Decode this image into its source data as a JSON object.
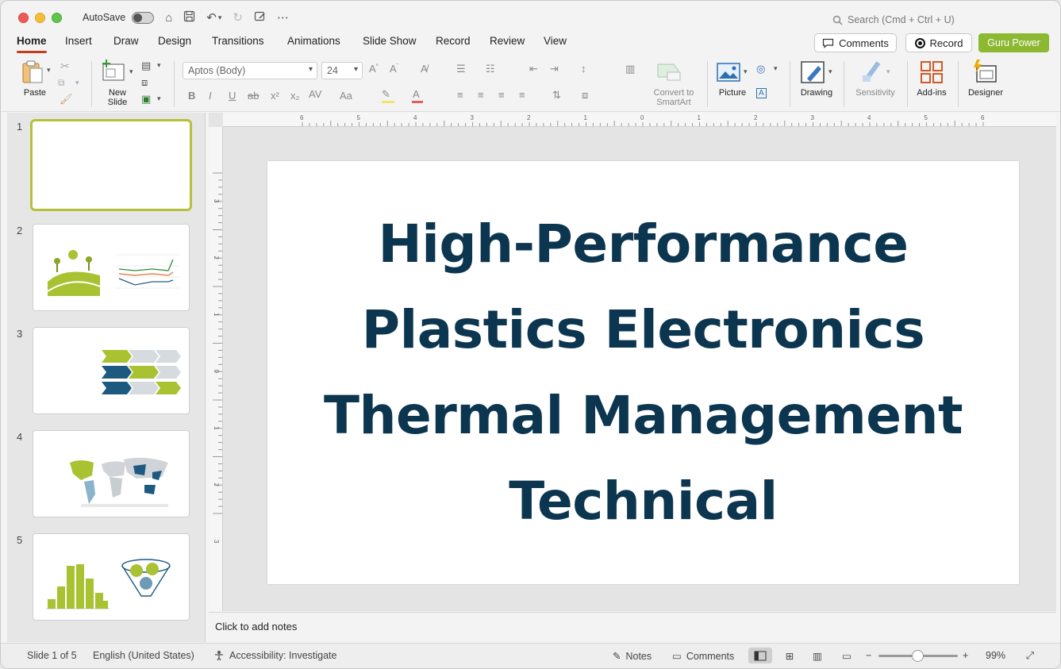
{
  "titlebar": {
    "autosave_label": "AutoSave",
    "search_placeholder": "Search (Cmd + Ctrl + U)"
  },
  "tabs": [
    "Home",
    "Insert",
    "Draw",
    "Design",
    "Transitions",
    "Animations",
    "Slide Show",
    "Record",
    "Review",
    "View"
  ],
  "header_buttons": {
    "comments": "Comments",
    "record": "Record",
    "guru": "Guru Power"
  },
  "ribbon": {
    "paste": "Paste",
    "new_slide_line1": "New",
    "new_slide_line2": "Slide",
    "font_name": "Aptos (Body)",
    "font_size": "24",
    "convert_line1": "Convert to",
    "convert_line2": "SmartArt",
    "picture": "Picture",
    "drawing": "Drawing",
    "sensitivity": "Sensitivity",
    "addins": "Add-ins",
    "designer": "Designer"
  },
  "thumbnails": {
    "numbers": [
      "1",
      "2",
      "3",
      "4",
      "5"
    ],
    "selected": 1
  },
  "slide": {
    "title_lines": [
      "High-Performance",
      "Plastics Electronics",
      "Thermal Management",
      "Technical"
    ]
  },
  "notes_placeholder": "Click to add notes",
  "ruler": {
    "h_labels": [
      "6",
      "5",
      "4",
      "3",
      "2",
      "1",
      "0",
      "1",
      "2",
      "3",
      "4",
      "5",
      "6"
    ],
    "v_labels": [
      "3",
      "2",
      "1",
      "0",
      "1",
      "2",
      "3"
    ]
  },
  "status": {
    "slide_of": "Slide 1 of 5",
    "language": "English (United States)",
    "accessibility": "Accessibility: Investigate",
    "notes": "Notes",
    "comments": "Comments",
    "zoom_minus": "−",
    "zoom_plus": "+",
    "zoom_level": "99%"
  },
  "colors": {
    "title_text": "#0c3650",
    "accent_green": "#8cb832",
    "accent_tab": "#c43e1c"
  }
}
